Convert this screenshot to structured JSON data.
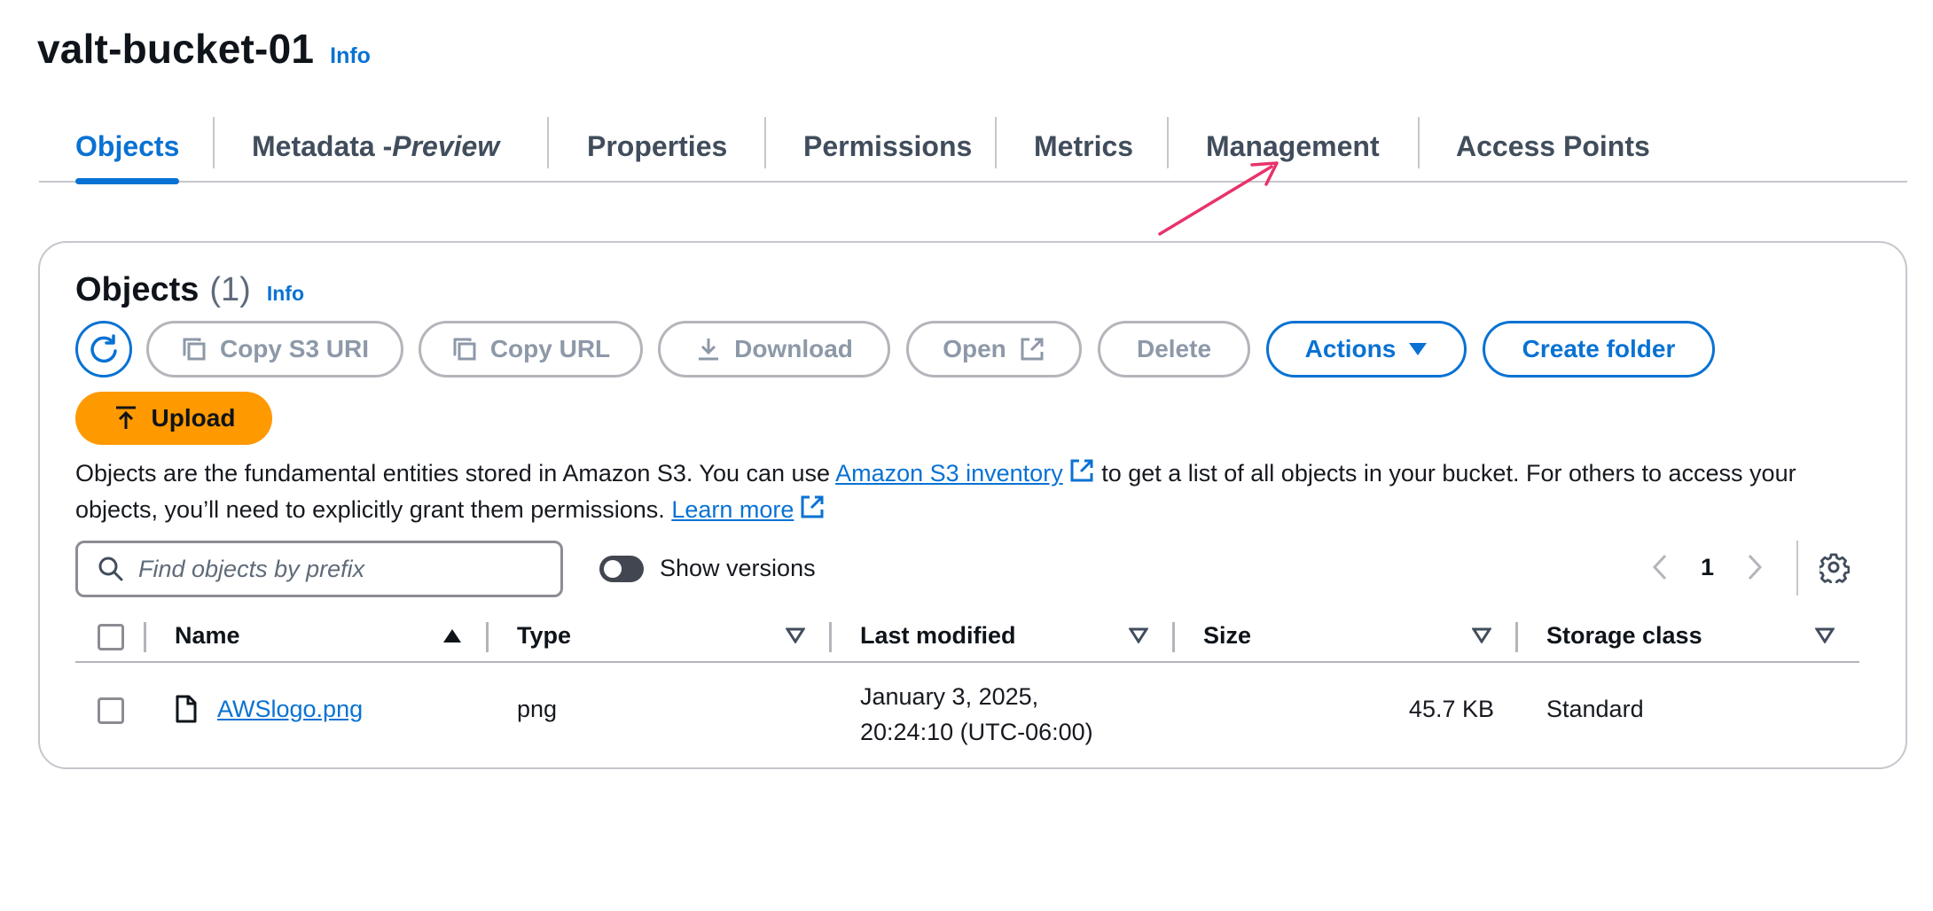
{
  "page": {
    "bucket_name": "valt-bucket-01",
    "info_label": "Info"
  },
  "tabs": [
    {
      "label": "Objects",
      "active": true
    },
    {
      "label": "Metadata - ",
      "label_italic": "Preview"
    },
    {
      "label": "Properties"
    },
    {
      "label": "Permissions"
    },
    {
      "label": "Metrics"
    },
    {
      "label": "Management"
    },
    {
      "label": "Access Points"
    }
  ],
  "objects_panel": {
    "title": "Objects",
    "count": "(1)",
    "info_label": "Info",
    "buttons": {
      "copy_s3_uri": "Copy S3 URI",
      "copy_url": "Copy URL",
      "download": "Download",
      "open": "Open",
      "delete": "Delete",
      "actions": "Actions",
      "create_folder": "Create folder",
      "upload": "Upload"
    },
    "description": {
      "part1": "Objects are the fundamental entities stored in Amazon S3. You can use ",
      "link1": "Amazon S3 inventory",
      "part2": " to get a list of all objects in your bucket. For others to access your objects, you’ll need to explicitly grant them permissions. ",
      "link2": "Learn more"
    },
    "search": {
      "placeholder": "Find objects by prefix",
      "value": ""
    },
    "show_versions": {
      "label": "Show versions",
      "enabled": false
    },
    "pagination": {
      "current_page": "1"
    }
  },
  "table": {
    "columns": [
      "Name",
      "Type",
      "Last modified",
      "Size",
      "Storage class"
    ],
    "rows": [
      {
        "name": "AWSlogo.png",
        "type": "png",
        "last_modified_line1": "January 3, 2025,",
        "last_modified_line2": "20:24:10 (UTC-06:00)",
        "size": "45.7 KB",
        "storage_class": "Standard"
      }
    ]
  },
  "colors": {
    "accent": "#0972d3",
    "upload": "#ff9900",
    "annotation_arrow": "#e8336b",
    "disabled_text": "#8d99a8"
  }
}
